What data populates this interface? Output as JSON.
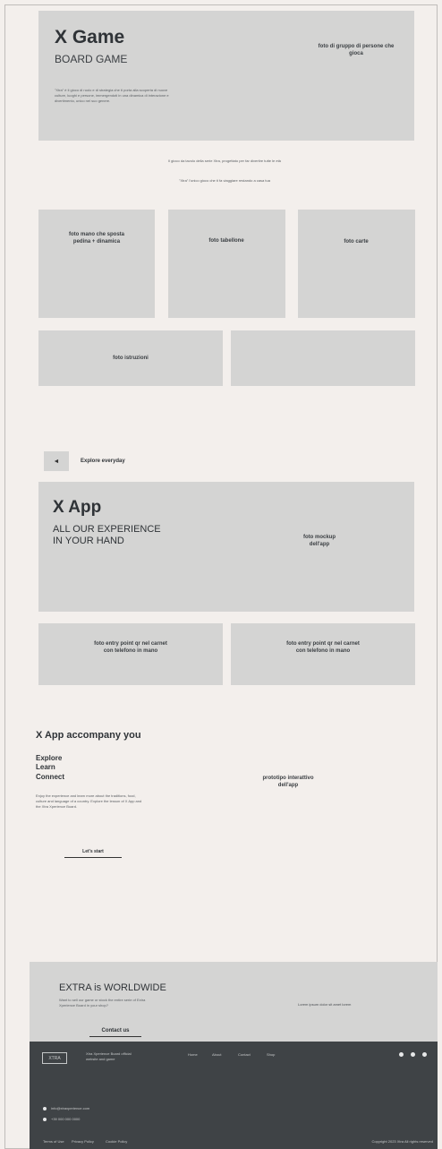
{
  "hero": {
    "title": "X Game",
    "subtitle": "BOARD GAME",
    "body": "\"Xtra\" è il gioco di ruolo e di strategia che ti porta alla scoperta di nuove culture, luoghi e persone, immergendoti in una dinamica di interazione e divertimento, unico nel suo genere.",
    "photo_caption": "foto di gruppo di persone che gioca"
  },
  "intro": {
    "line1": "Il gioco da tavolo della serie Xtra, progettato per far divertire tutte le età",
    "line2": "\"Xtra\" l'unico gioco che ti fa viaggiare restando a casa tua"
  },
  "photos": [
    "foto mano che sposta pedina + dinamica",
    "foto tabellone",
    "foto carte",
    "foto istruzioni",
    ""
  ],
  "explore": {
    "arrow": "◄",
    "label": "Explore everyday"
  },
  "app": {
    "title": "X App",
    "subtitle_line1": "ALL OUR EXPERIENCE",
    "subtitle_line2": "IN YOUR HAND",
    "mockup_caption": "foto mockup dell'app"
  },
  "app_photos": [
    "foto entry point qr nel carnet con telefono in mano",
    "foto entry point qr nel carnet con telefono in mano"
  ],
  "accompany": {
    "title": "X App accompany you",
    "list": [
      "Explore",
      "Learn",
      "Connect"
    ],
    "body": "Enjoy the experience and learn more about the traditions, food, culture and language of a country. Explore the lesson of X App and the Xtra Xperience Board.",
    "cta": "Let's start",
    "prototype_caption": "prototipo interattivo dell'app"
  },
  "extra": {
    "title": "EXTRA is WORLDWIDE",
    "body": "Want to sell our game or stock the entire serie of Extra Xperience Board in your shop?",
    "cta": "Contact us",
    "right_text": "Lorem ipsum dolor sit amet lorem"
  },
  "footer": {
    "logo": "XTRA",
    "tagline": "Xtra Xperience Board official website and game",
    "nav": [
      "Home",
      "About",
      "Contact",
      "Shop"
    ],
    "contact_1": "info@xtraxperience.com",
    "contact_2": "+39 000 000 0000",
    "links": [
      "Terms of Use",
      "Privacy Policy",
      "Cookie Policy"
    ],
    "copyright": "Copyright 2023 Xtra All rights reserved"
  }
}
